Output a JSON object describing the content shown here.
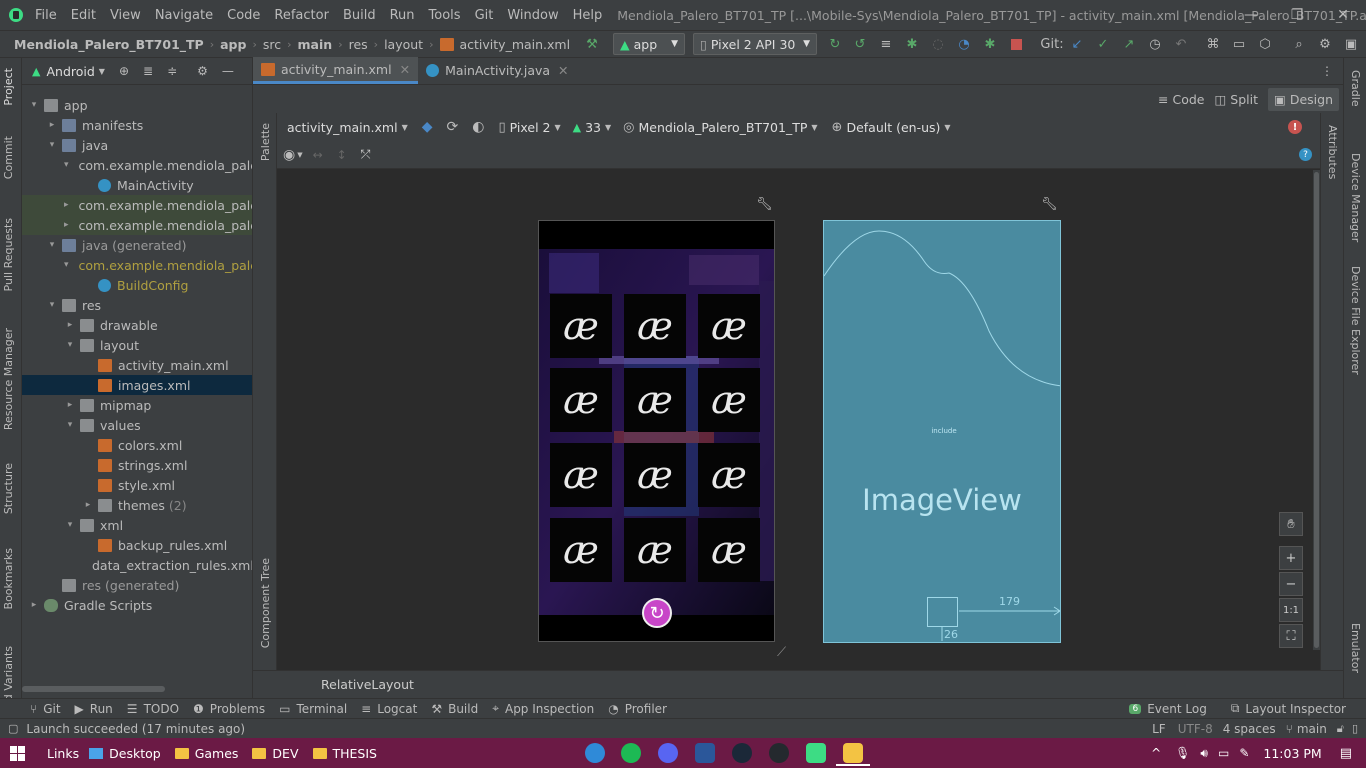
{
  "menu": [
    "File",
    "Edit",
    "View",
    "Navigate",
    "Code",
    "Refactor",
    "Build",
    "Run",
    "Tools",
    "Git",
    "Window",
    "Help"
  ],
  "window_title": "Mendiola_Palero_BT701_TP [...\\Mobile-Sys\\Mendiola_Palero_BT701_TP] - activity_main.xml [Mendiola_Palero_BT701_TP.app.main]",
  "breadcrumb": [
    "Mendiola_Palero_BT701_TP",
    "app",
    "src",
    "main",
    "res",
    "layout",
    "activity_main.xml"
  ],
  "toolbar": {
    "run_config": "app",
    "device": "Pixel 2 API 30",
    "git_label": "Git:"
  },
  "project_panel": {
    "view": "Android"
  },
  "tree": [
    {
      "label": "app",
      "indent": 0,
      "icon": "folder",
      "arrow": "▾"
    },
    {
      "label": "manifests",
      "indent": 1,
      "icon": "folder",
      "arrow": "▸"
    },
    {
      "label": "java",
      "indent": 1,
      "icon": "folder",
      "arrow": "▾"
    },
    {
      "label": "com.example.mendiola_pale",
      "indent": 2,
      "icon": "pkg",
      "arrow": "▾"
    },
    {
      "label": "MainActivity",
      "indent": 3,
      "icon": "cls",
      "arrow": ""
    },
    {
      "label": "com.example.mendiola_pale",
      "indent": 2,
      "icon": "pkg",
      "arrow": "▸"
    },
    {
      "label": "com.example.mendiola_pale",
      "indent": 2,
      "icon": "pkg",
      "arrow": "▸"
    },
    {
      "label": "java (generated)",
      "indent": 1,
      "icon": "folder",
      "arrow": "▾"
    },
    {
      "label": "com.example.mendiola_pale",
      "indent": 2,
      "icon": "pkg",
      "arrow": "▾"
    },
    {
      "label": "BuildConfig",
      "indent": 3,
      "icon": "cls",
      "arrow": ""
    },
    {
      "label": "res",
      "indent": 1,
      "icon": "res",
      "arrow": "▾"
    },
    {
      "label": "drawable",
      "indent": 2,
      "icon": "folder",
      "arrow": "▸"
    },
    {
      "label": "layout",
      "indent": 2,
      "icon": "folder",
      "arrow": "▾"
    },
    {
      "label": "activity_main.xml",
      "indent": 3,
      "icon": "xml",
      "arrow": ""
    },
    {
      "label": "images.xml",
      "indent": 3,
      "icon": "xml",
      "arrow": ""
    },
    {
      "label": "mipmap",
      "indent": 2,
      "icon": "folder",
      "arrow": "▸"
    },
    {
      "label": "values",
      "indent": 2,
      "icon": "folder",
      "arrow": "▾"
    },
    {
      "label": "colors.xml",
      "indent": 3,
      "icon": "xml",
      "arrow": ""
    },
    {
      "label": "strings.xml",
      "indent": 3,
      "icon": "xml",
      "arrow": ""
    },
    {
      "label": "style.xml",
      "indent": 3,
      "icon": "xml",
      "arrow": ""
    },
    {
      "label": "themes",
      "indent": 3,
      "icon": "folder",
      "arrow": "▸",
      "suffix": "(2)"
    },
    {
      "label": "xml",
      "indent": 2,
      "icon": "folder",
      "arrow": "▾"
    },
    {
      "label": "backup_rules.xml",
      "indent": 3,
      "icon": "xml",
      "arrow": ""
    },
    {
      "label": "data_extraction_rules.xml",
      "indent": 3,
      "icon": "xml",
      "arrow": ""
    },
    {
      "label": "res (generated)",
      "indent": 1,
      "icon": "res",
      "arrow": ""
    },
    {
      "label": "Gradle Scripts",
      "indent": 0,
      "icon": "gradle",
      "arrow": "▸"
    }
  ],
  "selected_item": "images.xml",
  "editor_tabs": [
    "activity_main.xml",
    "MainActivity.java"
  ],
  "view_modes": [
    "Code",
    "Split",
    "Design"
  ],
  "design_toolbar": {
    "file": "activity_main.xml",
    "device": "Pixel 2",
    "api": "33",
    "theme": "Mendiola_Palero_BT701_TP",
    "locale": "Default (en-us)"
  },
  "left_tabs": [
    "Project",
    "Commit",
    "Pull Requests",
    "Resource Manager",
    "Structure",
    "Bookmarks",
    "Build Variants"
  ],
  "right_tabs": [
    "Gradle",
    "Device Manager",
    "Device File Explorer",
    "Emulator"
  ],
  "attributes_tab": "Attributes",
  "palette_tab": "Palette",
  "component_tree_tab": "Component Tree",
  "blueprint": {
    "include": "include",
    "imageview": "ImageView",
    "dim_179": "179",
    "dim_26": "26"
  },
  "tile_glyph": "ӕ",
  "bottom_label": "RelativeLayout",
  "tool_windows": [
    "Git",
    "Run",
    "TODO",
    "Problems",
    "Terminal",
    "Logcat",
    "Build",
    "App Inspection",
    "Profiler"
  ],
  "right_tools": {
    "event_log": "Event Log",
    "event_count": "6",
    "layout_inspector": "Layout Inspector"
  },
  "status": {
    "message": "Launch succeeded (17 minutes ago)",
    "lf": "LF",
    "encoding": "UTF-8",
    "indent": "4 spaces",
    "branch": "main"
  },
  "taskbar": {
    "links": "Links",
    "desktop": "Desktop",
    "games": "Games",
    "dev": "DEV",
    "thesis": "THESIS",
    "time": "11:03 PM"
  },
  "colors": {
    "accent": "#4a88c7",
    "taskbar": "#6b1a45",
    "blueprint": "#4a8ba0"
  }
}
